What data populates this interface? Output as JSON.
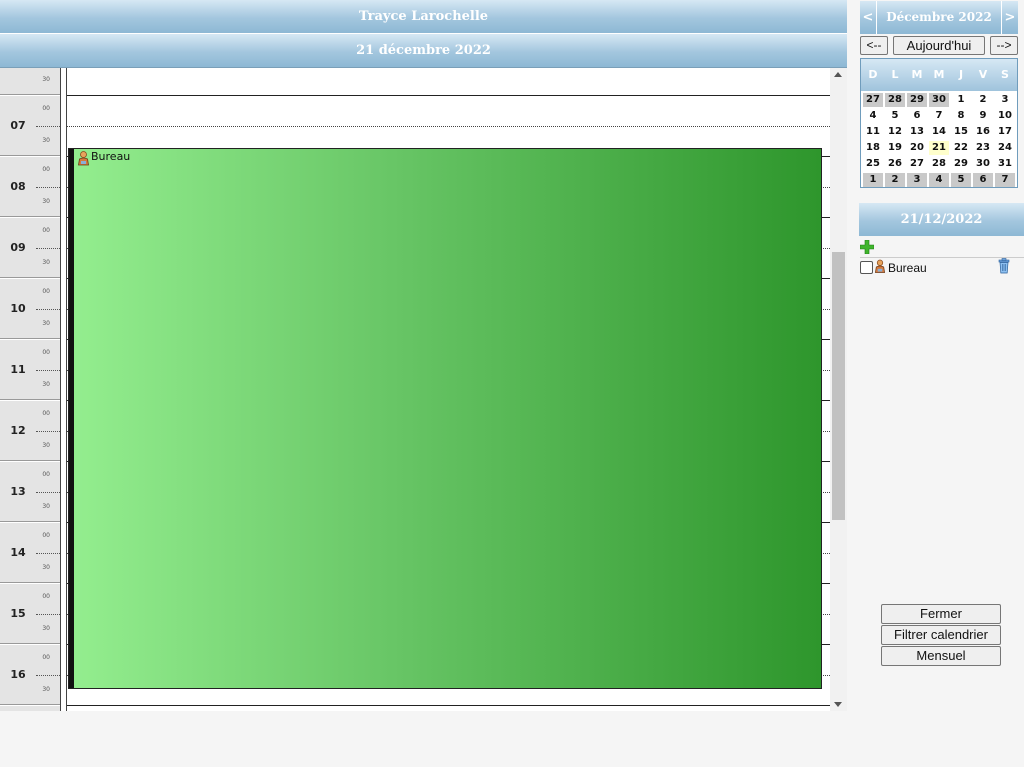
{
  "header": {
    "user_name": "Trayce Larochelle",
    "date_title": "21 décembre 2022"
  },
  "grid": {
    "hours": [
      "07",
      "08",
      "09",
      "10",
      "11",
      "12",
      "13",
      "14",
      "15",
      "16"
    ],
    "minute_top": "00",
    "minute_bottom": "30"
  },
  "event": {
    "label": "Bureau",
    "icon": "person-icon",
    "color_start": "#94ee8f",
    "color_end": "#2e962c"
  },
  "mini_calendar": {
    "prev": "<",
    "next": ">",
    "title": "Décembre 2022",
    "btn_prev": "<--",
    "btn_today": "Aujourd'hui",
    "btn_next": "-->",
    "weekdays": [
      "D",
      "L",
      "M",
      "M",
      "J",
      "V",
      "S"
    ],
    "weeks": [
      [
        {
          "d": "27",
          "o": true
        },
        {
          "d": "28",
          "o": true
        },
        {
          "d": "29",
          "o": true
        },
        {
          "d": "30",
          "o": true
        },
        {
          "d": "1"
        },
        {
          "d": "2"
        },
        {
          "d": "3"
        }
      ],
      [
        {
          "d": "4"
        },
        {
          "d": "5"
        },
        {
          "d": "6"
        },
        {
          "d": "7"
        },
        {
          "d": "8"
        },
        {
          "d": "9"
        },
        {
          "d": "10"
        }
      ],
      [
        {
          "d": "11"
        },
        {
          "d": "12"
        },
        {
          "d": "13"
        },
        {
          "d": "14"
        },
        {
          "d": "15"
        },
        {
          "d": "16"
        },
        {
          "d": "17"
        }
      ],
      [
        {
          "d": "18"
        },
        {
          "d": "19"
        },
        {
          "d": "20"
        },
        {
          "d": "21",
          "t": true
        },
        {
          "d": "22"
        },
        {
          "d": "23"
        },
        {
          "d": "24"
        }
      ],
      [
        {
          "d": "25"
        },
        {
          "d": "26"
        },
        {
          "d": "27"
        },
        {
          "d": "28"
        },
        {
          "d": "29"
        },
        {
          "d": "30"
        },
        {
          "d": "31"
        }
      ],
      [
        {
          "d": "1",
          "o": true
        },
        {
          "d": "2",
          "o": true
        },
        {
          "d": "3",
          "o": true
        },
        {
          "d": "4",
          "o": true
        },
        {
          "d": "5",
          "o": true
        },
        {
          "d": "6",
          "o": true
        },
        {
          "d": "7",
          "o": true
        }
      ]
    ]
  },
  "day_panel": {
    "date": "21/12/2022",
    "events": [
      {
        "label": "Bureau"
      }
    ]
  },
  "buttons": {
    "close": "Fermer",
    "filter": "Filtrer calendrier",
    "monthly": "Mensuel"
  }
}
